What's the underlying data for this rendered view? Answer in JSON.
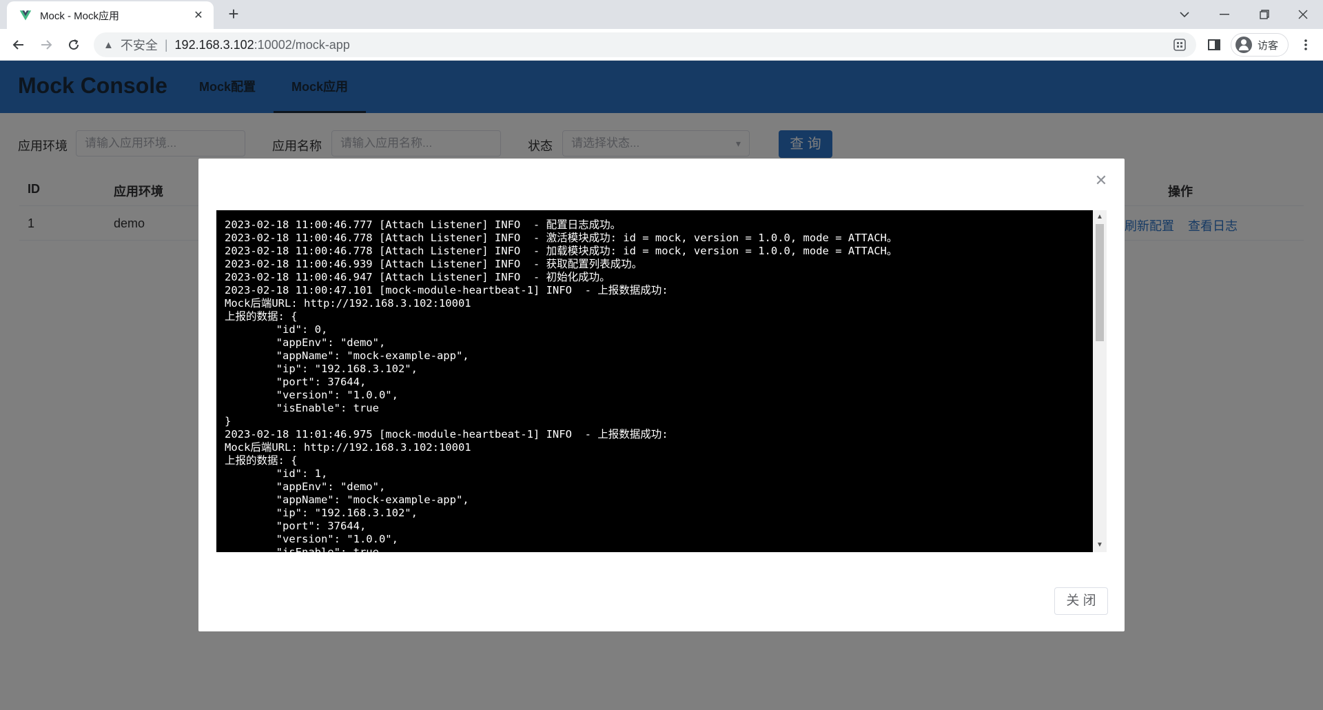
{
  "browser": {
    "tab_title": "Mock - Mock应用",
    "tab_close": "✕",
    "new_tab": "+",
    "security_label": "不安全",
    "url_separator": "|",
    "url_host": "192.168.3.102",
    "url_path": ":10002/mock-app",
    "profile_name": "访客",
    "favicon_color": "#41b883"
  },
  "app": {
    "brand": "Mock Console",
    "nav": [
      {
        "label": "Mock配置",
        "active": false
      },
      {
        "label": "Mock应用",
        "active": true
      }
    ],
    "accent_color": "#2c74c8"
  },
  "filters": {
    "env_label": "应用环境",
    "env_placeholder": "请输入应用环境...",
    "name_label": "应用名称",
    "name_placeholder": "请输入应用名称...",
    "status_label": "状态",
    "status_placeholder": "请选择状态...",
    "query_button": "查 询"
  },
  "table": {
    "headers": {
      "id": "ID",
      "env": "应用环境",
      "actions": "操作"
    },
    "rows": [
      {
        "id": "1",
        "env": "demo",
        "action_refresh": "刷新配置",
        "action_log": "查看日志"
      }
    ]
  },
  "dialog": {
    "close_icon": "✕",
    "close_button": "关 闭",
    "log_text": "2023-02-18 11:00:46.777 [Attach Listener] INFO  - 配置日志成功。\n2023-02-18 11:00:46.778 [Attach Listener] INFO  - 激活模块成功: id = mock, version = 1.0.0, mode = ATTACH。\n2023-02-18 11:00:46.778 [Attach Listener] INFO  - 加载模块成功: id = mock, version = 1.0.0, mode = ATTACH。\n2023-02-18 11:00:46.939 [Attach Listener] INFO  - 获取配置列表成功。\n2023-02-18 11:00:46.947 [Attach Listener] INFO  - 初始化成功。\n2023-02-18 11:00:47.101 [mock-module-heartbeat-1] INFO  - 上报数据成功:\nMock后端URL: http://192.168.3.102:10001\n上报的数据: {\n        \"id\": 0,\n        \"appEnv\": \"demo\",\n        \"appName\": \"mock-example-app\",\n        \"ip\": \"192.168.3.102\",\n        \"port\": 37644,\n        \"version\": \"1.0.0\",\n        \"isEnable\": true\n}\n2023-02-18 11:01:46.975 [mock-module-heartbeat-1] INFO  - 上报数据成功:\nMock后端URL: http://192.168.3.102:10001\n上报的数据: {\n        \"id\": 1,\n        \"appEnv\": \"demo\",\n        \"appName\": \"mock-example-app\",\n        \"ip\": \"192.168.3.102\",\n        \"port\": 37644,\n        \"version\": \"1.0.0\",\n        \"isEnable\": true\n}"
  }
}
